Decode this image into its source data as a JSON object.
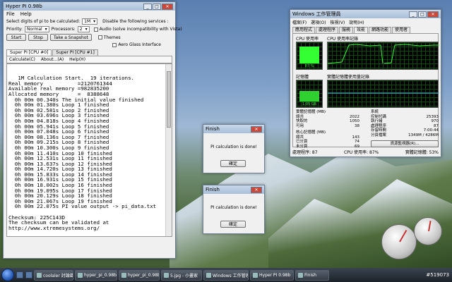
{
  "hyper": {
    "title": "Hyper PI 0.98b",
    "menu": [
      "File",
      "Help"
    ],
    "digits_label": "Select digits of pi to be calculated:",
    "digits_value": "1M",
    "services_label": "Disable the following services :",
    "audio_label": "Audio (solve incompatibility with Vista)",
    "themes_label": "Themes",
    "aero_label": "Aero Glass Interface",
    "priority_label": "Priority:",
    "priority_value": "Normal",
    "processors_label": "Processors:",
    "processors_value": "2",
    "start_label": "Start",
    "stop_label": "Stop",
    "snapshot_label": "Take a Snapshot",
    "tabs": [
      "Super PI [CPU #0]",
      "Super PI [CPU #1]"
    ],
    "inner_menu": [
      "Calculate(C)",
      "About...(A)",
      "Help(H)"
    ],
    "console_lines": [
      "   1M Calculation Start.  19 iterations.",
      "Real memory           =2120761344",
      "Available real memory =982835200",
      "Allocated memory      =  8388648",
      "  0h 00m 00.340s The initial value finished",
      "  0h 00m 01.380s Loop 1 finished",
      "  0h 00m 02.581s Loop 2 finished",
      "  0h 00m 03.696s Loop 3 finished",
      "  0h 00m 04.818s Loop 4 finished",
      "  0h 00m 05.941s Loop 5 finished",
      "  0h 00m 07.048s Loop 6 finished",
      "  0h 00m 08.136s Loop 7 finished",
      "  0h 00m 09.215s Loop 8 finished",
      "  0h 00m 10.300s Loop 9 finished",
      "  0h 00m 11.410s Loop 10 finished",
      "  0h 00m 12.531s Loop 11 finished",
      "  0h 00m 13.637s Loop 12 finished",
      "  0h 00m 14.720s Loop 13 finished",
      "  0h 00m 15.833s Loop 14 finished",
      "  0h 00m 16.931s Loop 15 finished",
      "  0h 00m 18.002s Loop 16 finished",
      "  0h 00m 19.095s Loop 17 finished",
      "  0h 00m 20.129s Loop 18 finished",
      "  0h 00m 21.067s Loop 19 finished",
      "  0h 00m 22.075s PI value output -> pi_data.txt",
      "",
      "Checksum: 225C143D",
      "The checksum can be validated at",
      "http://www.xtremesystems.org/"
    ]
  },
  "taskmgr": {
    "title": "Windows 工作管理員",
    "menu": [
      "檔案(F)",
      "選項(O)",
      "檢視(V)",
      "說明(H)"
    ],
    "tabs": [
      "應用程式",
      "處理程序",
      "服務",
      "效能",
      "網路功能",
      "使用者"
    ],
    "active_tab_index": 3,
    "cpu_label": "CPU 使用率",
    "cpu_value": "87 %",
    "cpu_fraction": 0.87,
    "cpu_history_label": "CPU 使用率記錄",
    "mem_label": "記憶體",
    "mem_value": "1.05 GB",
    "mem_fraction": 0.53,
    "mem_history_label": "實體記憶體使用量記錄",
    "phys_title": "實體記憶體 (MB)",
    "phys_rows": [
      [
        "總共",
        "2022"
      ],
      [
        "快取的",
        "1050"
      ],
      [
        "可用",
        "38"
      ]
    ],
    "core_title": "核心記憶體 (MB)",
    "core_rows": [
      [
        "總共",
        "143"
      ],
      [
        "已分頁",
        "74"
      ],
      [
        "未分頁",
        "69"
      ]
    ],
    "system_title": "系統",
    "system_rows": [
      [
        "控制代碼",
        "25393"
      ],
      [
        "執行緒",
        "970"
      ],
      [
        "處理程序",
        "87"
      ],
      [
        "存留時間",
        "7:00:44"
      ],
      [
        "分頁檔案",
        "1349M / 4286M"
      ]
    ],
    "resource_btn": "資源監視器(R)...",
    "status": [
      "處理程序: 87",
      "CPU 使用率: 87%",
      "實體記憶體: 53%"
    ]
  },
  "dialog1": {
    "title": "Finish",
    "message": "PI calculation is done!",
    "ok": "確定"
  },
  "dialog2": {
    "title": "Finish",
    "message": "PI calculation is done!",
    "ok": "確定"
  },
  "taskbar": {
    "items": [
      "coolaler 討論區",
      "hyper_pi_0.98b",
      "hyper_pi_0.98b",
      "5.jpg - 小畫家",
      "Windows 工作管理員",
      "Hyper PI 0.98b",
      "Finish"
    ],
    "watermark": "#519073"
  }
}
